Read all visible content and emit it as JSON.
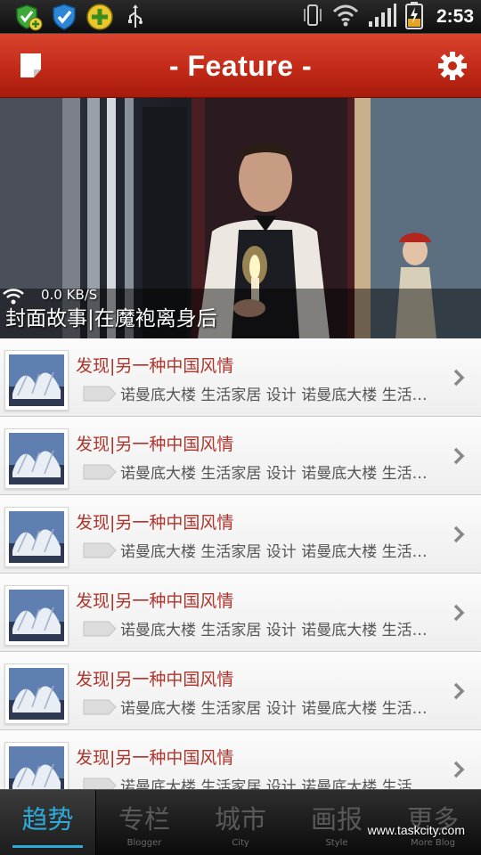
{
  "status_bar": {
    "time": "2:53",
    "icons": [
      "shield-plus-icon",
      "shield-check-icon",
      "plus-circle-icon",
      "usb-icon",
      "vibrate-icon",
      "wifi-icon",
      "signal-icon",
      "battery-icon"
    ]
  },
  "header": {
    "title": "- Feature -",
    "left_icon": "note-icon",
    "right_icon": "gear-icon"
  },
  "hero": {
    "caption": "封面故事|在魔袍离身后",
    "speed": "0.0 KB/S"
  },
  "list": {
    "items": [
      {
        "title": "发现|另一种中国风情",
        "desc": "诺曼底大楼 生活家居 设计  诺曼底大楼 生活家居"
      },
      {
        "title": "发现|另一种中国风情",
        "desc": "诺曼底大楼 生活家居 设计  诺曼底大楼 生活家居"
      },
      {
        "title": "发现|另一种中国风情",
        "desc": "诺曼底大楼 生活家居 设计  诺曼底大楼 生活家居"
      },
      {
        "title": "发现|另一种中国风情",
        "desc": "诺曼底大楼 生活家居 设计  诺曼底大楼 生活家居"
      },
      {
        "title": "发现|另一种中国风情",
        "desc": "诺曼底大楼 生活家居 设计  诺曼底大楼 生活家居"
      },
      {
        "title": "发现|另一种中国风情",
        "desc": "诺曼底大楼 生活家居 设计  诺曼底大楼 生活家居"
      }
    ]
  },
  "bottom_nav": {
    "tabs": [
      {
        "label": "趋势",
        "sub": ""
      },
      {
        "label": "专栏",
        "sub": "Blogger"
      },
      {
        "label": "城市",
        "sub": "City"
      },
      {
        "label": "画报",
        "sub": "Style"
      },
      {
        "label": "更多",
        "sub": "More Blog"
      }
    ],
    "active_index": 0
  },
  "watermark": "www.taskcity.com",
  "colors": {
    "header_red": "#c32a18",
    "title_red": "#b2342a",
    "active_blue": "#2fa9d8"
  }
}
